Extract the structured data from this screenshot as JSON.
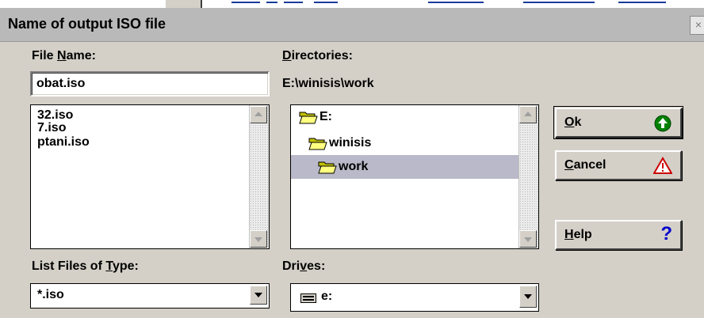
{
  "dialog": {
    "title": "Name of output ISO file",
    "close_glyph": "×"
  },
  "file_name": {
    "label_pre": "File ",
    "label_key": "N",
    "label_post": "ame:",
    "value": "obat.iso",
    "files": [
      "32.iso",
      "7.iso",
      "ptani.iso"
    ]
  },
  "directories": {
    "label_key": "D",
    "label_post": "irectories:",
    "current_path": "E:\\winisis\\work",
    "folders": [
      {
        "name": "E:",
        "icon": "open-folder-icon",
        "selected": false
      },
      {
        "name": "winisis",
        "icon": "open-folder-icon",
        "selected": false
      },
      {
        "name": "work",
        "icon": "open-folder-icon",
        "selected": true
      }
    ]
  },
  "file_type": {
    "label_pre": "List Files of ",
    "label_key": "T",
    "label_post": "ype:",
    "value": "*.iso"
  },
  "drives": {
    "label_pre": "Dri",
    "label_key": "v",
    "label_post": "es:",
    "value": "e:",
    "icon": "drive-icon"
  },
  "buttons": {
    "ok": {
      "key": "O",
      "rest": "k",
      "icon": "green-up-arrow-icon",
      "icon_color": "#008000"
    },
    "cancel": {
      "key": "C",
      "rest": "ancel",
      "icon": "warning-triangle-icon",
      "icon_color": "#cc0000"
    },
    "help": {
      "key": "H",
      "rest": "elp",
      "icon": "question-mark-icon",
      "icon_color": "#0000cc",
      "glyph": "?"
    }
  }
}
